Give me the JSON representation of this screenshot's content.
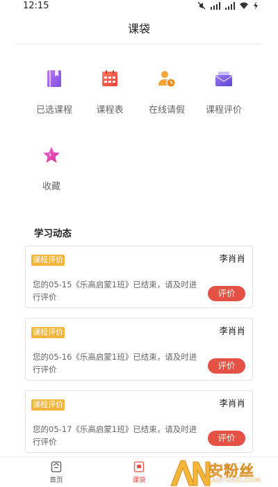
{
  "status_bar": {
    "time": "12:15"
  },
  "header": {
    "title": "课袋"
  },
  "grid": {
    "items": [
      {
        "label": "已选课程",
        "icon": "book-icon",
        "color": "#9b5ee8"
      },
      {
        "label": "课程表",
        "icon": "calendar-icon",
        "color": "#f0594a"
      },
      {
        "label": "在线请假",
        "icon": "user-clock-icon",
        "color": "#f3a43a"
      },
      {
        "label": "课程评价",
        "icon": "mail-box-icon",
        "color": "#7b5ee8"
      },
      {
        "label": "收藏",
        "icon": "star-icon",
        "color": "#e83ea8"
      }
    ]
  },
  "section": {
    "title": "学习动态"
  },
  "cards": [
    {
      "tag": "课程评价",
      "name": "李肖肖",
      "message": "您的05-15《乐高启蒙1班》已结束，请及时进行评价",
      "button": "评价"
    },
    {
      "tag": "课程评价",
      "name": "李肖肖",
      "message": "您的05-16《乐高启蒙1班》已结束，请及时进行评价",
      "button": "评价"
    },
    {
      "tag": "课程评价",
      "name": "李肖肖",
      "message": "您的05-17《乐高启蒙1班》已结束，请及时进行评价",
      "button": "评价"
    }
  ],
  "tabbar": {
    "items": [
      {
        "label": "首页",
        "icon": "home-icon"
      },
      {
        "label": "课袋",
        "icon": "bag-icon"
      }
    ],
    "active": "课袋"
  },
  "watermark": {
    "text": "安粉丝",
    "sub": "ANFENSI.COM",
    "logo": "AN"
  },
  "colors": {
    "accent": "#e35245",
    "tag": "#f3b53a"
  }
}
